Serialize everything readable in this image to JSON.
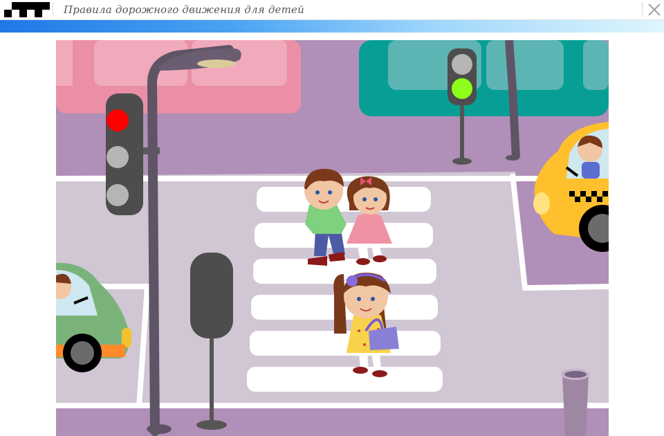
{
  "window": {
    "title": "Правила дорожного движения для детей",
    "logo_icon": "checkered-flag-icon",
    "close_icon": "close-icon",
    "accent_gradient": [
      "#1f78e6",
      "#dff6fd"
    ]
  },
  "scene": {
    "subject": "pedestrian-crossing",
    "pedestrian_light_color": "#8cff1a",
    "car_light_color": "#ff0000",
    "road_color": "#d1c6d4",
    "sidewalk_color": "#b08fb8"
  }
}
